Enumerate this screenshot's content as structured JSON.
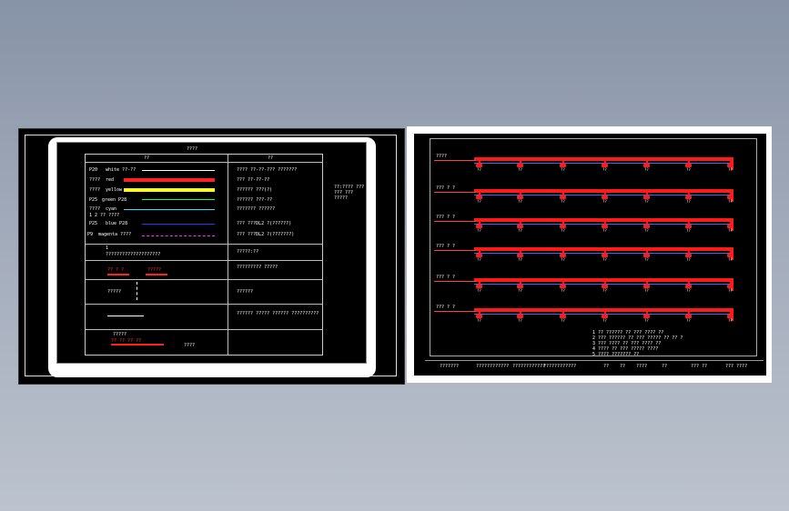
{
  "left_sheet": {
    "title": "????",
    "header_left": "??",
    "header_right": "??",
    "rows": [
      {
        "code": "P20",
        "label": "white ??-??",
        "note": "???? ??-??-??? ???????"
      },
      {
        "code": "????",
        "label": "red",
        "note": "??? ??-??-??"
      },
      {
        "code": "????",
        "label": "yellow",
        "note": "?????? ???(?)"
      },
      {
        "code": "P25",
        "label": "green P28",
        "note": "?????? ???-??"
      },
      {
        "code": "????",
        "label": "cyan",
        "note": "??????? ??????"
      },
      {
        "code": "",
        "label": "1 2 ?? ????",
        "note": ""
      },
      {
        "code": "P25",
        "label": "blue P28",
        "note": "??? ???DL2 ?(??????)"
      },
      {
        "code": "P9",
        "label": "magenta ????",
        "note": "??? ???DL2 ?(???????)"
      }
    ],
    "side_note": [
      "??:???? ???",
      "??? ???",
      "?????"
    ],
    "cells": [
      {
        "left": "1",
        "left2": "????????????????????",
        "right": "?????:??"
      },
      {
        "left": "?? ? ?",
        "left2": "?????",
        "right": "????????? ?????"
      },
      {
        "left": "?????",
        "left2": "",
        "right": "??????"
      },
      {
        "left": "",
        "left2": "",
        "right": "?????? ????? ?????? ??????????"
      },
      {
        "left": "?????",
        "left2": "?? ?? ?? ??",
        "right": "????"
      }
    ],
    "legend_colors": [
      "#ff2020",
      "#ffff00",
      "#00ff66",
      "#22e0ff",
      "#3030ff",
      "#ff30ff"
    ]
  },
  "right_sheet": {
    "row_labels": [
      "????",
      "??? ? ?",
      "??? ? ?",
      "??? ? ?",
      "??? ? ?",
      "??? ? ?"
    ],
    "drop_tag": "??",
    "notes": [
      "1 ?? ?????? ?? ??? ???? ??",
      "2 ??? ?????? ?? ??? ????? ?? ?? ?",
      "3 ??? ???? ?? ??? ???? ??",
      "4 ???? ?? ??? ????? ????",
      "5 ???? ??????? ??"
    ],
    "title_block": [
      "???????",
      "????????????",
      "????????????",
      "??",
      "??",
      "????",
      "??",
      "??? ??",
      "??? ????"
    ]
  },
  "colors": {
    "background_top": "#8793a6",
    "background_bottom": "#bcc3ce",
    "pipe": "#ff1a1a",
    "drawing_bg": "#000000"
  }
}
